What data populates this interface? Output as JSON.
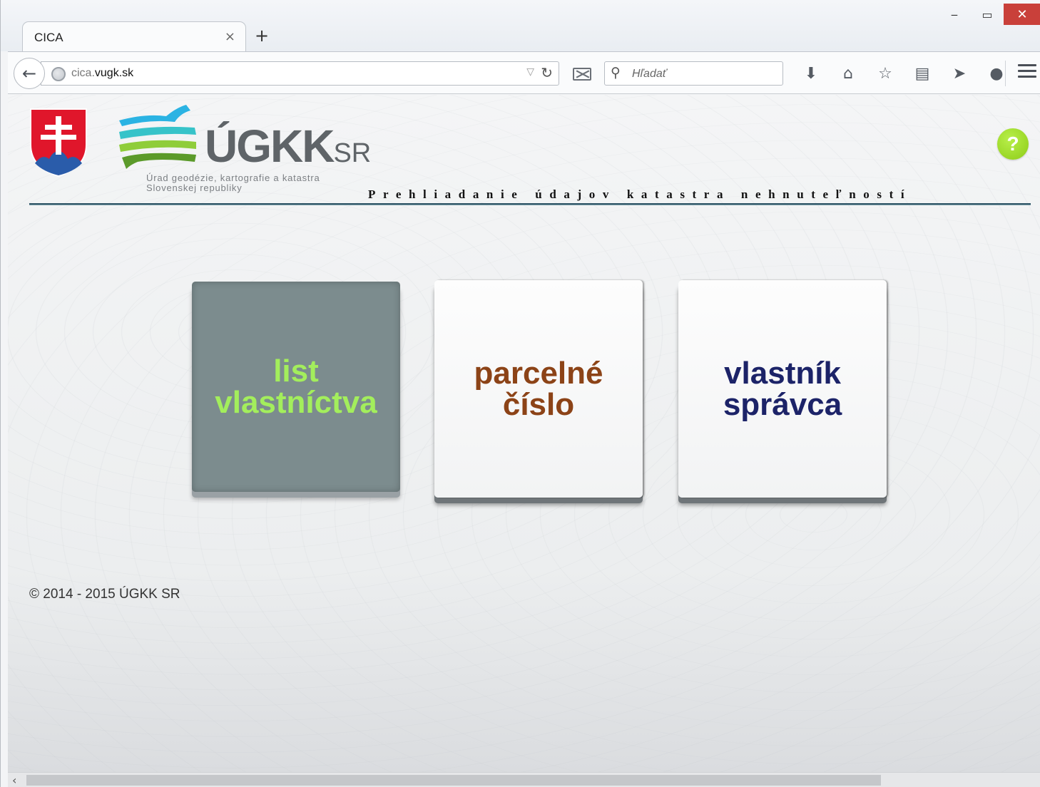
{
  "browser": {
    "tab_title": "CICA",
    "tab_close": "×",
    "new_tab": "+",
    "url_prefix": "cica.",
    "url_domain": "vugk.sk",
    "search_placeholder": "Hľadať",
    "window_controls": {
      "minimize": "‒",
      "maximize": "▭",
      "close": "✕"
    },
    "icons": [
      "download-icon",
      "home-icon",
      "bookmark-star-icon",
      "reading-list-icon",
      "share-icon",
      "chat-icon"
    ]
  },
  "header": {
    "logo_main": "ÚGKK",
    "logo_suffix": "SR",
    "logo_subtitle_line1": "Úrad geodézie, kartografie a katastra",
    "logo_subtitle_line2": "Slovenskej republiky",
    "page_heading": "Prehliadanie údajov katastra nehnuteľností",
    "help_label": "?"
  },
  "tiles": [
    {
      "line1": "list",
      "line2": "vlastníctva",
      "active": true
    },
    {
      "line1": "parcelné",
      "line2": "číslo",
      "active": false
    },
    {
      "line1": "vlastník",
      "line2": "správca",
      "active": false
    }
  ],
  "footer": {
    "copyright": "© 2014 - 2015 ÚGKK SR"
  },
  "colors": {
    "tile1_text": "#a3ee5c",
    "tile2_text": "#8c4317",
    "tile3_text": "#1c2368",
    "active_tile_bg": "#7c8c8e",
    "help_green": "#8dcc17",
    "header_rule": "#2f5566"
  }
}
